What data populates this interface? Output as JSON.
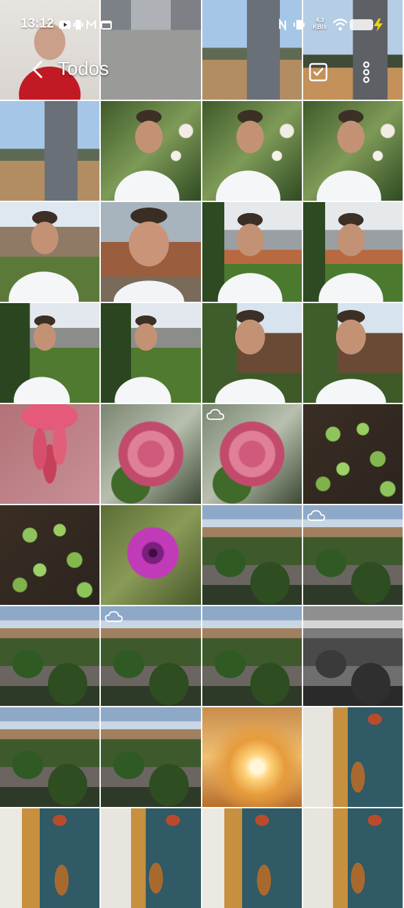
{
  "status_bar": {
    "time": "13:12",
    "network_speed_value": "4,3",
    "network_speed_unit": "KB/s",
    "icons": [
      "youtube-icon",
      "vibrate-icon",
      "gmail-icon",
      "calendar-icon",
      "nfc-icon",
      "vibrate-icon",
      "wifi-icon",
      "battery-icon",
      "charging-icon"
    ]
  },
  "top_bar": {
    "title": "Todos",
    "back_icon": "chevron-left-icon",
    "select_icon": "checkbox-icon",
    "more_icon": "more-vertical-icon"
  },
  "photos": [
    {
      "style": "p-portrait-red",
      "cloud": false
    },
    {
      "style": "p-building",
      "cloud": false
    },
    {
      "style": "p-tower",
      "cloud": false
    },
    {
      "style": "p-tower2",
      "cloud": false
    },
    {
      "style": "p-tower",
      "cloud": false
    },
    {
      "style": "p-selfie-garden",
      "cloud": false
    },
    {
      "style": "p-selfie-garden",
      "cloud": false
    },
    {
      "style": "p-selfie-garden",
      "cloud": false
    },
    {
      "style": "p-selfie-house",
      "cloud": false
    },
    {
      "style": "p-selfie-close",
      "cloud": false
    },
    {
      "style": "p-selfie-wall",
      "cloud": false
    },
    {
      "style": "p-selfie-wall",
      "cloud": false
    },
    {
      "style": "p-selfie-tree",
      "cloud": false
    },
    {
      "style": "p-selfie-tree",
      "cloud": false
    },
    {
      "style": "p-selfie-roof",
      "cloud": false
    },
    {
      "style": "p-selfie-roof",
      "cloud": false
    },
    {
      "style": "p-flower-red",
      "cloud": false
    },
    {
      "style": "p-rose",
      "cloud": false
    },
    {
      "style": "p-rose",
      "cloud": true
    },
    {
      "style": "p-plants",
      "cloud": false
    },
    {
      "style": "p-plants",
      "cloud": false
    },
    {
      "style": "p-petunia",
      "cloud": false
    },
    {
      "style": "p-sky",
      "cloud": false
    },
    {
      "style": "p-sky",
      "cloud": true
    },
    {
      "style": "p-sky",
      "cloud": false
    },
    {
      "style": "p-sky",
      "cloud": true
    },
    {
      "style": "p-sky",
      "cloud": false
    },
    {
      "style": "p-sky-bw",
      "cloud": false
    },
    {
      "style": "p-sky",
      "cloud": false
    },
    {
      "style": "p-sky",
      "cloud": false
    },
    {
      "style": "p-glow",
      "cloud": false
    },
    {
      "style": "p-room",
      "cloud": false
    },
    {
      "style": "p-room2",
      "cloud": false
    },
    {
      "style": "p-room",
      "cloud": false
    },
    {
      "style": "p-room2",
      "cloud": false
    },
    {
      "style": "p-room",
      "cloud": false
    }
  ]
}
